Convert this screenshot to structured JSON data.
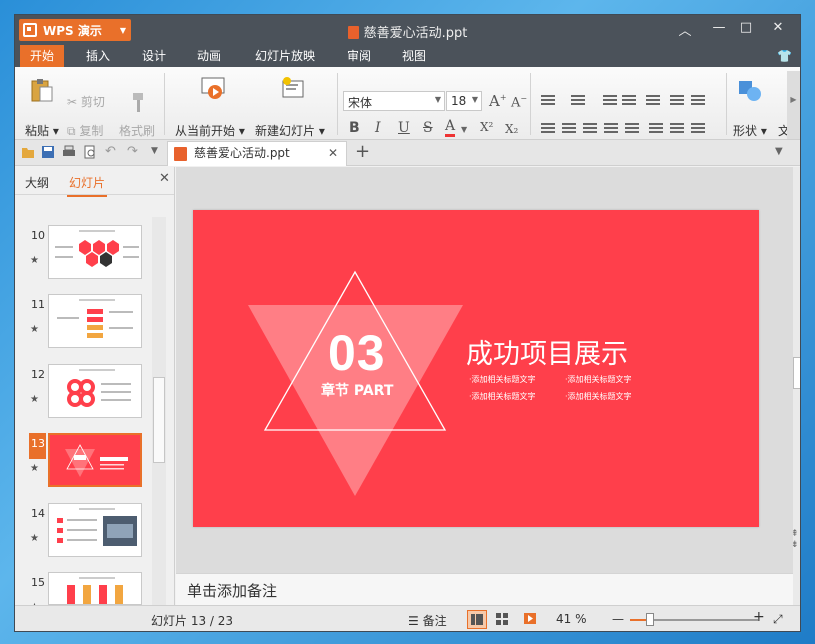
{
  "titlebar": {
    "app_name": "WPS 演示",
    "doc_title": "慈善爱心活动.ppt",
    "controls": [
      "︿",
      "—",
      "□",
      "✕"
    ]
  },
  "menu": {
    "tabs": [
      "开始",
      "插入",
      "设计",
      "动画",
      "幻灯片放映",
      "审阅",
      "视图"
    ],
    "active": "开始"
  },
  "ribbon": {
    "paste": "粘贴",
    "cut": "剪切",
    "copy": "复制",
    "format_painter": "格式刷",
    "play_from_current": "从当前开始",
    "new_slide": "新建幻灯片",
    "font_name": "宋体",
    "font_size": "18",
    "bold": "B",
    "italic": "I",
    "underline": "U",
    "strike": "S",
    "font_color": "A",
    "superscript": "X²",
    "subscript": "X₂",
    "grow": "A",
    "shrink": "A",
    "shapes": "形状",
    "text_more": "文"
  },
  "doc_tab": {
    "name": "慈善爱心活动.ppt",
    "close": "✕",
    "new": "+"
  },
  "left_pane": {
    "tab_outline": "大纲",
    "tab_slides": "幻灯片",
    "close": "✕",
    "thumbs": [
      {
        "num": "10",
        "star": "★"
      },
      {
        "num": "11",
        "star": "★"
      },
      {
        "num": "12",
        "star": "★"
      },
      {
        "num": "13",
        "star": "★"
      },
      {
        "num": "14",
        "star": "★"
      },
      {
        "num": "15",
        "star": "★"
      }
    ],
    "selected": "13"
  },
  "slide": {
    "number": "03",
    "part": "章节 PART",
    "title": "成功项目展示",
    "bullets": [
      "·添加相关标题文字",
      "·添加相关标题文字",
      "·添加相关标题文字",
      "·添加相关标题文字"
    ],
    "colors": {
      "background": "#ff3f4b",
      "accent": "#e9702a"
    }
  },
  "notes": {
    "placeholder": "单击添加备注"
  },
  "status": {
    "slide_counter": "幻灯片 13 / 23",
    "notes_btn": "备注",
    "zoom": "41 %",
    "zoom_minus": "—",
    "zoom_plus": "+",
    "zoom_level": 0.41
  }
}
